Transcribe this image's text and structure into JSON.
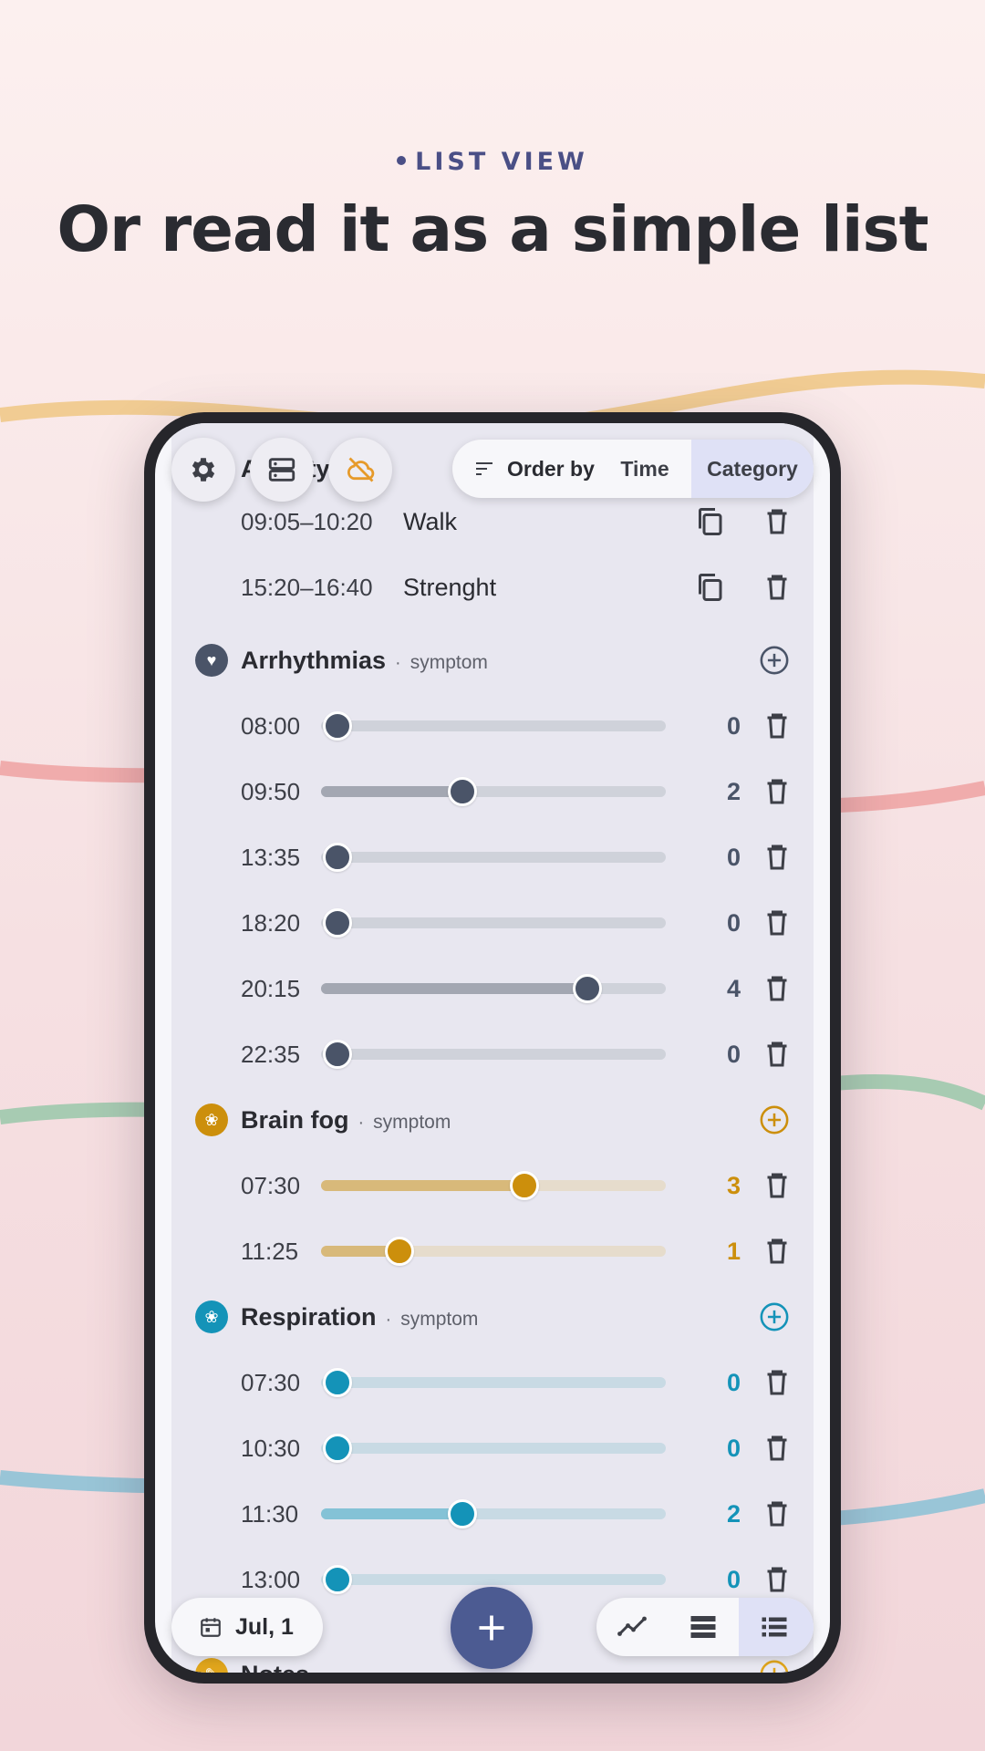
{
  "header": {
    "eyebrow": "LIST VIEW",
    "headline": "Or read it as a simple list"
  },
  "toolbar": {
    "order_by_label": "Order by",
    "order_options": [
      "Time",
      "Category"
    ],
    "selected_order": "Category",
    "partial_title": "Activity"
  },
  "activities": [
    {
      "time": "09:05–10:20",
      "name": "Walk"
    },
    {
      "time": "15:20–16:40",
      "name": "Strenght"
    }
  ],
  "categories": [
    {
      "name": "Arrhythmias",
      "type": "symptom",
      "color": "#4a5468",
      "light": "#cfd2da",
      "fill": "#a3a7b2",
      "entries": [
        {
          "time": "08:00",
          "value": 0
        },
        {
          "time": "09:50",
          "value": 2
        },
        {
          "time": "13:35",
          "value": 0
        },
        {
          "time": "18:20",
          "value": 0
        },
        {
          "time": "20:15",
          "value": 4
        },
        {
          "time": "22:35",
          "value": 0
        }
      ]
    },
    {
      "name": "Brain fog",
      "type": "symptom",
      "color": "#cc8f0c",
      "light": "#e6dccc",
      "fill": "#d8b97a",
      "entries": [
        {
          "time": "07:30",
          "value": 3
        },
        {
          "time": "11:25",
          "value": 1
        }
      ]
    },
    {
      "name": "Respiration",
      "type": "symptom",
      "color": "#1493b8",
      "light": "#c8dae4",
      "fill": "#84c2d6",
      "entries": [
        {
          "time": "07:30",
          "value": 0
        },
        {
          "time": "10:30",
          "value": 0
        },
        {
          "time": "11:30",
          "value": 2
        },
        {
          "time": "13:00",
          "value": 0
        }
      ]
    }
  ],
  "notes": {
    "name": "Notes",
    "color": "#e0a51c"
  },
  "scale_max": 5,
  "bottom": {
    "date": "Jul, 1",
    "views": [
      "chart-view",
      "timeline-view",
      "list-view"
    ],
    "selected_view": "list-view"
  }
}
